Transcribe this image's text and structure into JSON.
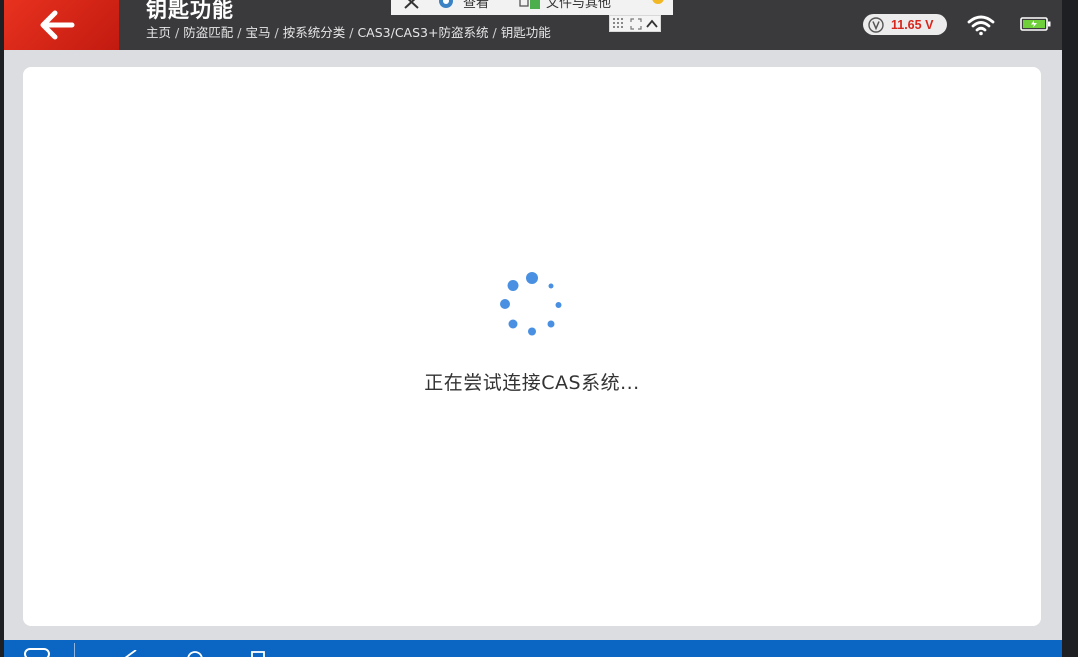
{
  "header": {
    "title": "钥匙功能",
    "breadcrumb": [
      "主页",
      "防盗匹配",
      "宝马",
      "按系统分类",
      "CAS3/CAS3+防盗系统",
      "钥匙功能"
    ]
  },
  "overlay": {
    "item1": "查看",
    "item2": "文件与其他"
  },
  "status": {
    "voltage": "11.65 V",
    "voltage_color": "#d7261d",
    "wifi_icon": "wifi-icon",
    "battery_icon": "battery-icon"
  },
  "main": {
    "loading_text": "正在尝试连接CAS系统..."
  },
  "colors": {
    "accent_red": "#d42718",
    "header_bg": "#3a3a3d",
    "spinner_blue": "#4a90e2",
    "navbar_blue": "#0a66c2"
  }
}
